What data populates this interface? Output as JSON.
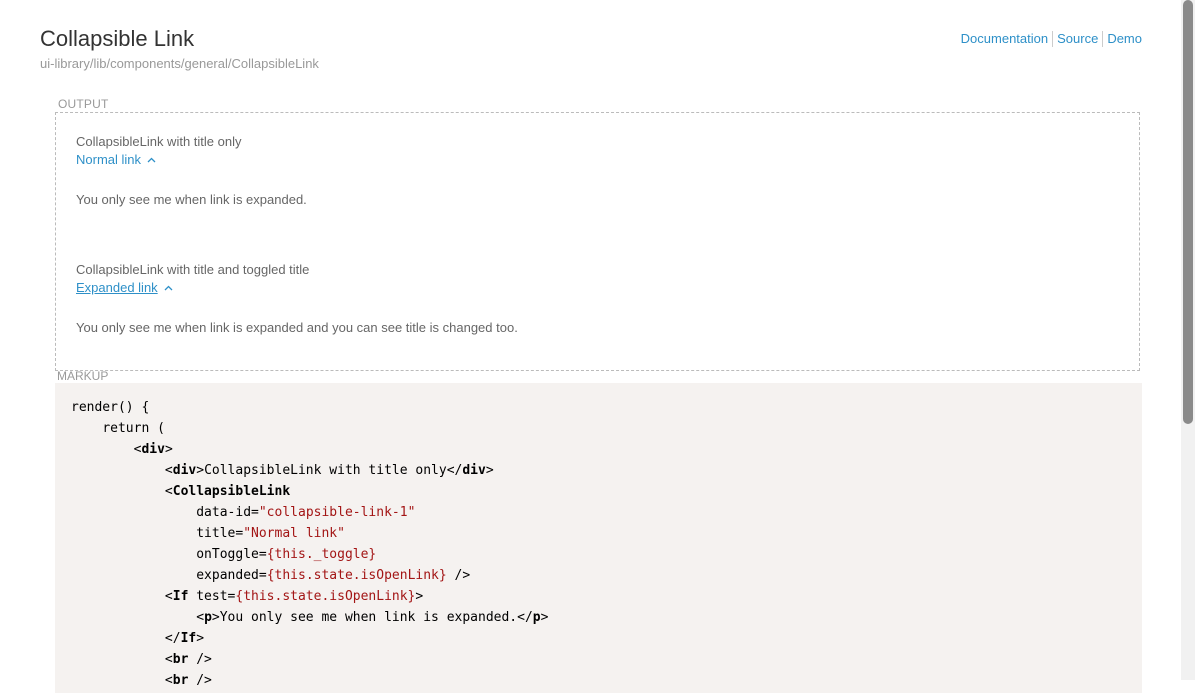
{
  "header": {
    "title": "Collapsible Link",
    "path": "ui-library/lib/components/general/CollapsibleLink",
    "links": [
      "Documentation",
      "Source",
      "Demo"
    ]
  },
  "output": {
    "label": "OUTPUT",
    "demo1": {
      "heading": "CollapsibleLink with title only",
      "link": "Normal link",
      "content": "You only see me when link is expanded."
    },
    "demo2": {
      "heading": "CollapsibleLink with title and toggled title",
      "link": "Expanded link",
      "content": "You only see me when link is expanded and you can see title is changed too."
    }
  },
  "markup": {
    "label": "MARKUP",
    "code": {
      "l1": "render() {",
      "l2": "return (",
      "div": "div",
      "div_text": "CollapsibleLink with title only",
      "collapsible": "CollapsibleLink",
      "data_id_attr": "data-id=",
      "data_id_val": "\"collapsible-link-1\"",
      "title_attr": "title=",
      "title_val": "\"Normal link\"",
      "ontoggle_attr": "onToggle=",
      "ontoggle_val": "{this._toggle}",
      "expanded_attr": "expanded=",
      "expanded_val": "{this.state.isOpenLink}",
      "if": "If",
      "test_attr": "test=",
      "test_val": "{this.state.isOpenLink}",
      "p": "p",
      "p_text": "You only see me when link is expanded.",
      "br": "br"
    }
  }
}
